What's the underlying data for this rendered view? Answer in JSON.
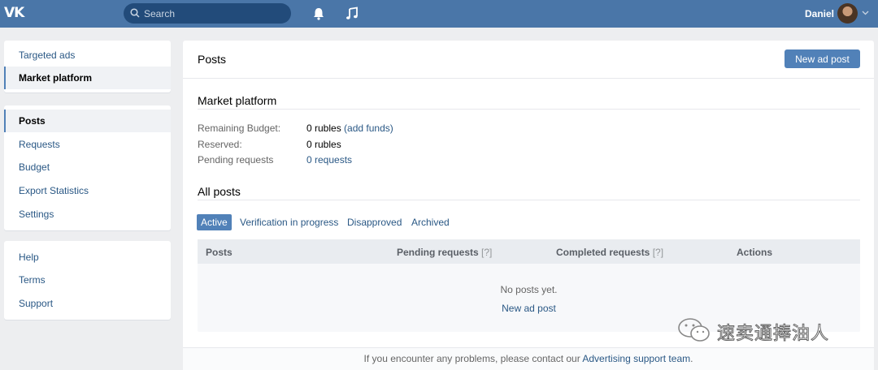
{
  "app": {
    "logo": "VK"
  },
  "topbar": {
    "search_placeholder": "Search",
    "user_name": "Daniel",
    "icons": [
      "bell-icon",
      "music-icon",
      "search-icon",
      "chevron-down-icon"
    ]
  },
  "nav": {
    "group1": [
      {
        "label": "Targeted ads",
        "active": false
      },
      {
        "label": "Market platform",
        "active": true
      }
    ],
    "group2": [
      {
        "label": "Posts",
        "active": true
      },
      {
        "label": "Requests",
        "active": false
      },
      {
        "label": "Budget",
        "active": false
      },
      {
        "label": "Export Statistics",
        "active": false
      },
      {
        "label": "Settings",
        "active": false
      }
    ],
    "group3": [
      {
        "label": "Help"
      },
      {
        "label": "Terms"
      },
      {
        "label": "Support"
      }
    ]
  },
  "main": {
    "title": "Posts",
    "new_post_button": "New ad post",
    "market": {
      "title": "Market platform",
      "rows": [
        {
          "label": "Remaining Budget:",
          "value": "0 rubles",
          "link": "(add funds)"
        },
        {
          "label": "Reserved:",
          "value": "0 rubles",
          "link": ""
        },
        {
          "label": "Pending requests",
          "value": "",
          "link": "0 requests"
        }
      ]
    },
    "all_posts": {
      "title": "All posts",
      "tabs": [
        {
          "label": "Active",
          "active": true
        },
        {
          "label": "Verification in progress",
          "active": false
        },
        {
          "label": "Disapproved",
          "active": false
        },
        {
          "label": "Archived",
          "active": false
        }
      ],
      "columns": [
        {
          "label": "Posts",
          "hint": ""
        },
        {
          "label": "Pending requests",
          "hint": "[?]"
        },
        {
          "label": "Completed requests",
          "hint": "[?]"
        },
        {
          "label": "Actions",
          "hint": ""
        }
      ],
      "empty_text": "No posts yet.",
      "empty_link": "New ad post"
    },
    "footer": {
      "text": "If you encounter any problems, please contact our ",
      "link": "Advertising support team",
      "end": "."
    }
  },
  "watermark": {
    "text": "速卖通捧油人"
  },
  "colors": {
    "header": "#4a76a8",
    "accent": "#5181b8",
    "link": "#2a5885",
    "background": "#edeef0"
  }
}
